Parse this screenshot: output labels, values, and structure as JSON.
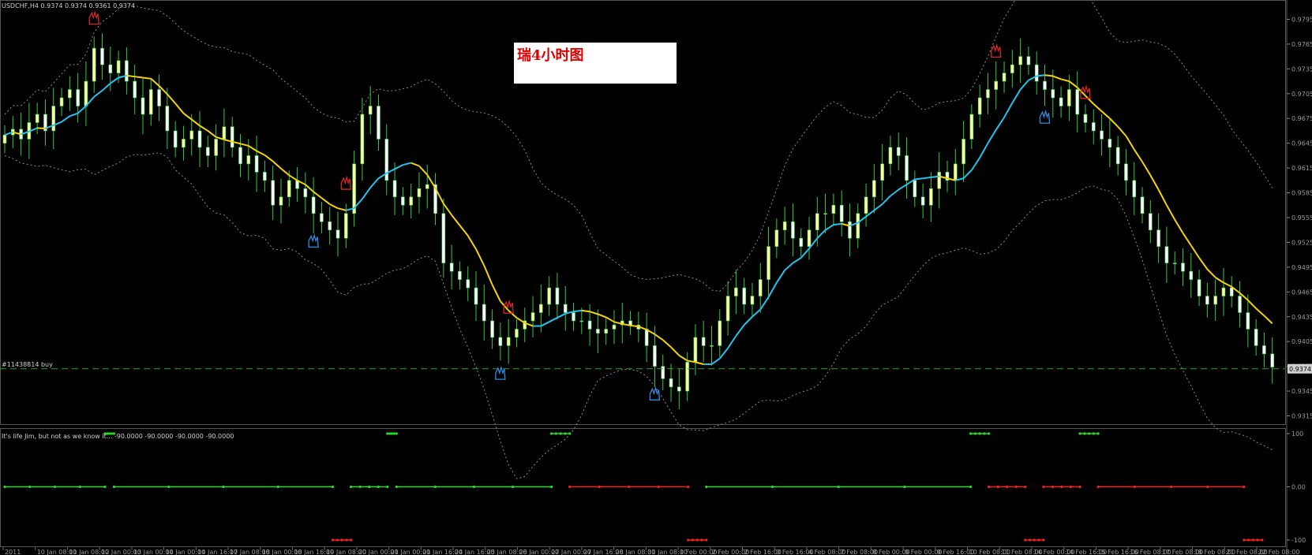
{
  "header_text": "USDCHF,H4  0.9374 0.9374 0.9361 0.9374",
  "annotation": "瑞4小时图",
  "order_label": "#11438814 buy",
  "indicator_label": "It's life Jim, but not as we know it... -90.0000 -90.0000 -90.0000 -90.0000",
  "colors": {
    "bull": "#ffffaa",
    "bear": "#ffffff",
    "wick": "#2ecc40",
    "ma_up": "#22c3ee",
    "ma_down": "#f3d500",
    "band": "#8a8a8a",
    "order_line": "#22aa22",
    "ind_up": "#22dd22",
    "ind_down": "#ee2222",
    "sell_hand": "#dd2222",
    "buy_hand": "#2a8ce0"
  },
  "price_axis": {
    "ticks": [
      "0.9795",
      "0.9765",
      "0.9735",
      "0.9705",
      "0.9675",
      "0.9645",
      "0.9615",
      "0.9585",
      "0.9555",
      "0.9525",
      "0.9495",
      "0.9465",
      "0.9435",
      "0.9405",
      "0.9375",
      "0.9345",
      "0.9315"
    ],
    "current_price": "0.9374"
  },
  "indicator_axis": {
    "ticks": [
      "100",
      "0.00",
      "-100"
    ]
  },
  "time_axis": [
    "2011",
    "10 Jan 08:00",
    "11 Jan 08:00",
    "12 Jan 00:00",
    "13 Jan 00:00",
    "14 Jan 00:00",
    "14 Jan 16:00",
    "17 Jan 08:00",
    "18 Jan 00:00",
    "18 Jan 16:00",
    "19 Jan 08:00",
    "20 Jan 00:00",
    "21 Jan 00:00",
    "21 Jan 16:00",
    "24 Jan 16:00",
    "25 Jan 08:00",
    "26 Jan 00:00",
    "27 Jan 00:00",
    "27 Jan 16:00",
    "28 Jan 08:00",
    "31 Jan 08:00",
    "1 Feb 00:00",
    "2 Feb 00:00",
    "2 Feb 16:00",
    "3 Feb 16:00",
    "4 Feb 08:00",
    "7 Feb 08:00",
    "8 Feb 00:00",
    "9 Feb 00:00",
    "9 Feb 16:00",
    "10 Feb 08:00",
    "11 Feb 08:00",
    "14 Feb 00:00",
    "14 Feb 16:00",
    "15 Feb 16:00",
    "16 Feb 08:00",
    "17 Feb 08:00",
    "18 Feb 08:00",
    "21 Feb 08:00",
    "22 Feb 08:00"
  ],
  "chart_data": {
    "type": "candlestick",
    "symbol": "USDCHF",
    "timeframe": "H4",
    "ylim": [
      0.9305,
      0.9805
    ],
    "close_series": [
      0.9655,
      0.9662,
      0.965,
      0.967,
      0.968,
      0.966,
      0.969,
      0.97,
      0.971,
      0.969,
      0.972,
      0.976,
      0.974,
      0.973,
      0.9745,
      0.972,
      0.97,
      0.968,
      0.971,
      0.969,
      0.966,
      0.964,
      0.965,
      0.966,
      0.964,
      0.963,
      0.965,
      0.9665,
      0.964,
      0.962,
      0.963,
      0.961,
      0.96,
      0.957,
      0.958,
      0.96,
      0.959,
      0.958,
      0.956,
      0.955,
      0.954,
      0.953,
      0.956,
      0.962,
      0.968,
      0.969,
      0.965,
      0.96,
      0.958,
      0.957,
      0.958,
      0.959,
      0.9595,
      0.956,
      0.95,
      0.949,
      0.948,
      0.947,
      0.945,
      0.943,
      0.941,
      0.94,
      0.941,
      0.942,
      0.943,
      0.944,
      0.945,
      0.947,
      0.945,
      0.944,
      0.943,
      0.943,
      0.942,
      0.9415,
      0.942,
      0.9425,
      0.943,
      0.9425,
      0.942,
      0.94,
      0.9375,
      0.936,
      0.935,
      0.9345,
      0.938,
      0.941,
      0.94,
      0.94,
      0.943,
      0.946,
      0.947,
      0.945,
      0.946,
      0.948,
      0.952,
      0.954,
      0.955,
      0.953,
      0.952,
      0.954,
      0.956,
      0.956,
      0.957,
      0.955,
      0.953,
      0.956,
      0.958,
      0.96,
      0.962,
      0.964,
      0.963,
      0.96,
      0.958,
      0.957,
      0.959,
      0.961,
      0.96,
      0.962,
      0.965,
      0.968,
      0.97,
      0.971,
      0.972,
      0.973,
      0.974,
      0.975,
      0.974,
      0.972,
      0.971,
      0.97,
      0.969,
      0.971,
      0.968,
      0.967,
      0.966,
      0.965,
      0.964,
      0.962,
      0.96,
      0.958,
      0.956,
      0.954,
      0.952,
      0.95,
      0.95,
      0.949,
      0.948,
      0.946,
      0.945,
      0.946,
      0.947,
      0.946,
      0.944,
      0.942,
      0.94,
      0.939,
      0.9374
    ],
    "markers": [
      {
        "type": "sell",
        "index": 11
      },
      {
        "type": "sell",
        "index": 42
      },
      {
        "type": "buy",
        "index": 38
      },
      {
        "type": "sell",
        "index": 62
      },
      {
        "type": "buy",
        "index": 61
      },
      {
        "type": "buy",
        "index": 80
      },
      {
        "type": "sell",
        "index": 122
      },
      {
        "type": "buy",
        "index": 128
      },
      {
        "type": "sell",
        "index": 133
      },
      {
        "type": "buy",
        "index": 158
      }
    ],
    "order_level": 0.9372,
    "indicator": {
      "ylim": [
        -100,
        100
      ],
      "segments": [
        {
          "from": 0,
          "to": 11,
          "value": 0
        },
        {
          "from": 11,
          "to": 12,
          "value": 100
        },
        {
          "from": 12,
          "to": 36,
          "value": 0
        },
        {
          "from": 36,
          "to": 38,
          "value": -100
        },
        {
          "from": 38,
          "to": 42,
          "value": 0
        },
        {
          "from": 42,
          "to": 43,
          "value": 100
        },
        {
          "from": 43,
          "to": 60,
          "value": 0
        },
        {
          "from": 60,
          "to": 62,
          "value": 100
        },
        {
          "from": 62,
          "to": 75,
          "value": 0
        },
        {
          "from": 75,
          "to": 77,
          "value": -100
        },
        {
          "from": 77,
          "to": 106,
          "value": 0
        },
        {
          "from": 106,
          "to": 108,
          "value": 100
        },
        {
          "from": 108,
          "to": 112,
          "value": 0
        },
        {
          "from": 112,
          "to": 114,
          "value": -100
        },
        {
          "from": 114,
          "to": 118,
          "value": 0
        },
        {
          "from": 118,
          "to": 120,
          "value": 100
        },
        {
          "from": 120,
          "to": 136,
          "value": 0
        },
        {
          "from": 136,
          "to": 138,
          "value": -100
        }
      ]
    }
  }
}
